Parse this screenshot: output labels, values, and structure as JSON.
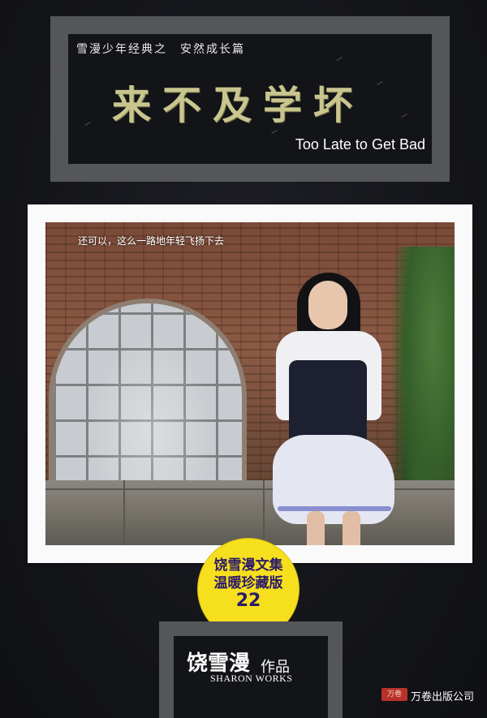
{
  "cover": {
    "series": "雪漫少年经典之　安然成长篇",
    "title": "来不及学坏",
    "title_en": "Too Late to Get Bad",
    "photo_caption": "还可以，这么一路地年轻飞扬下去",
    "badge": {
      "line1": "饶雪漫文集",
      "line2": "温暖珍藏版",
      "number": "22"
    },
    "author": {
      "name": "饶雪漫",
      "works": "作品",
      "name_en": "SHARON WORKS"
    },
    "publisher": {
      "logo_text": "万卷",
      "name": "万卷出版公司"
    }
  },
  "colors": {
    "background": "#15161b",
    "frame": "#54565a",
    "title": "#c9c58e",
    "badge": "#f6df1d",
    "badge_text": "#2b1a6a"
  }
}
